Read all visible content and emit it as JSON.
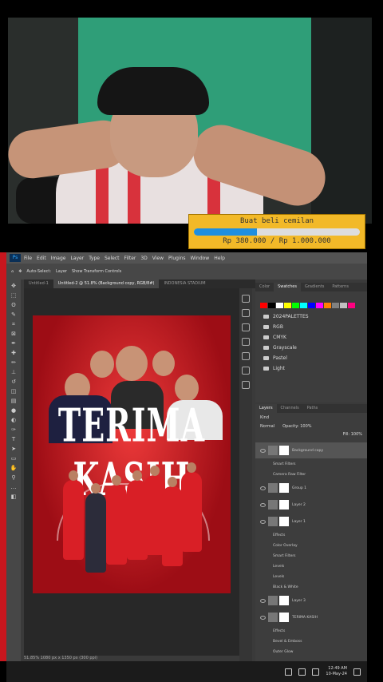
{
  "donation": {
    "label": "Buat beli cemilan",
    "amount": "Rp 380.000 / Rp 1.000.000",
    "progress_fraction": 0.38,
    "bar_color": "#1f8fe0",
    "bg_color": "#f2b928"
  },
  "photoshop": {
    "app_icon": "Ps",
    "menu": [
      "File",
      "Edit",
      "Image",
      "Layer",
      "Type",
      "Select",
      "Filter",
      "3D",
      "View",
      "Plugins",
      "Window",
      "Help"
    ],
    "options": {
      "auto_select": "Auto-Select:",
      "auto_select_value": "Layer",
      "show_transform": "Show Transform Controls"
    },
    "tabs": [
      "Untitled-1",
      "Untitled-2 @ 51.8% (Background copy, RGB/8#)",
      "INDONESIA STADIUM"
    ],
    "active_tab": 1,
    "poster_title": "TERIMA KASIH",
    "status_text": "51.85%    1080 px x 1350 px (300 ppi)",
    "swatches_tabs": [
      "Color",
      "Swatches",
      "Gradients",
      "Patterns"
    ],
    "swatches_active": 1,
    "swatch_colors": [
      "#ff0000",
      "#000000",
      "#ffffff",
      "#ffff00",
      "#00ff00",
      "#00ffff",
      "#0000ff",
      "#ff00ff",
      "#ff8000",
      "#808080",
      "#c0c0c0",
      "#ff0080"
    ],
    "swatch_folders": [
      "2024PALETTES",
      "RGB",
      "CMYK",
      "Grayscale",
      "Pastel",
      "Light"
    ],
    "layers_tabs": [
      "Layers",
      "Channels",
      "Paths"
    ],
    "layers_active": 0,
    "layers_kind": "Kind",
    "blend_mode": "Normal",
    "opacity": "Opacity: 100%",
    "fill": "Fill: 100%",
    "layers": [
      {
        "name": "Background copy",
        "sub": false,
        "selected": true
      },
      {
        "name": "Smart Filters",
        "sub": true
      },
      {
        "name": "Camera Raw Filter",
        "sub": true
      },
      {
        "name": "Group 1",
        "sub": false
      },
      {
        "name": "Layer 2",
        "sub": false
      },
      {
        "name": "Layer 1",
        "sub": false
      },
      {
        "name": "Effects",
        "sub": true
      },
      {
        "name": "Color Overlay",
        "sub": true
      },
      {
        "name": "Smart Filters",
        "sub": true
      },
      {
        "name": "Levels",
        "sub": true
      },
      {
        "name": "Levels",
        "sub": true
      },
      {
        "name": "Black & White",
        "sub": true
      },
      {
        "name": "Layer 3",
        "sub": false
      },
      {
        "name": "TERIMA KASIH",
        "sub": false
      },
      {
        "name": "Effects",
        "sub": true
      },
      {
        "name": "Bevel & Emboss",
        "sub": true
      },
      {
        "name": "Outer Glow",
        "sub": true
      }
    ]
  },
  "taskbar": {
    "time": "12:49 AM",
    "date": "10-May-24"
  }
}
